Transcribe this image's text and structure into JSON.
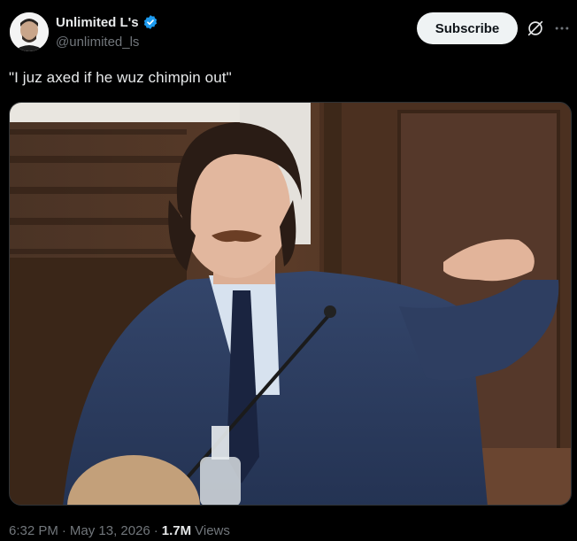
{
  "author": {
    "display_name": "Unlimited L's",
    "handle": "@unlimited_ls",
    "verified": true,
    "verified_color": "#1d9bf0"
  },
  "actions": {
    "subscribe_label": "Subscribe",
    "grok_icon": "grok-icon",
    "more_icon": "more-icon"
  },
  "tweet": {
    "text": "\"I juz axed if he wuz chimpin out\""
  },
  "meta": {
    "time": "6:32 PM",
    "separator": "·",
    "date": "May 13, 2026",
    "views_count": "1.7M",
    "views_label": "Views"
  },
  "colors": {
    "background": "#000000",
    "text": "#e7e9ea",
    "secondary": "#71767b",
    "button_bg": "#eff3f4"
  }
}
